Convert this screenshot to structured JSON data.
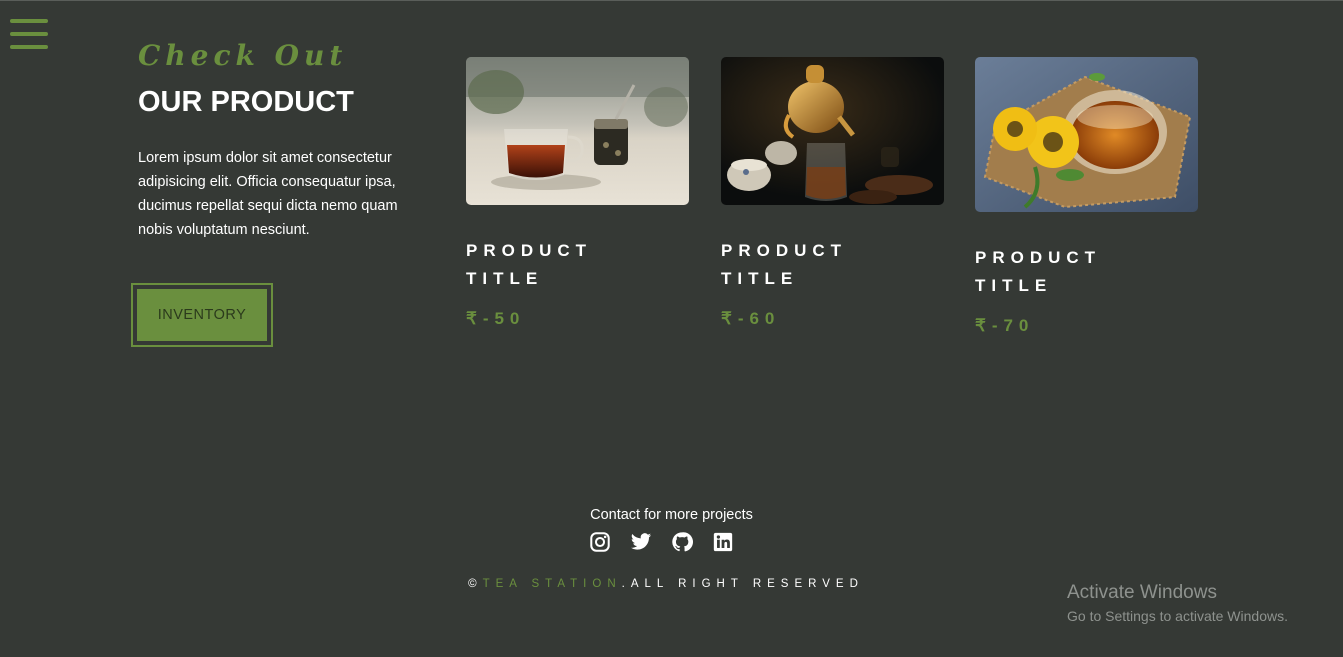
{
  "nav": {
    "menu_icon": "hamburger-menu-icon"
  },
  "intro": {
    "kicker": "Check Out",
    "heading": "OUR PRODUCT",
    "description": "Lorem ipsum dolor sit amet consectetur adipisicing elit. Officia consequatur ipsa, ducimus repellat sequi dicta nemo quam nobis voluptatum nesciunt.",
    "button_label": "INVENTORY"
  },
  "products": [
    {
      "title_line1": "PRODUCT",
      "title_line2": "TITLE",
      "price": "₹-50",
      "image": "glass-tea-cup-on-table-photo"
    },
    {
      "title_line1": "PRODUCT",
      "title_line2": "TITLE",
      "price": "₹-60",
      "image": "teapot-pouring-tea-photo"
    },
    {
      "title_line1": "PRODUCT",
      "title_line2": "TITLE",
      "price": "₹-70",
      "image": "tea-cup-with-yellow-flowers-photo"
    }
  ],
  "footer": {
    "contact_text": "Contact for more projects",
    "social_icons": [
      "instagram-icon",
      "twitter-icon",
      "github-icon",
      "linkedin-icon"
    ],
    "copyright_symbol": "©",
    "brand": "TEA STATION",
    "rights": ".ALL RIGHT RESERVED"
  },
  "watermark": {
    "title": "Activate Windows",
    "subtitle": "Go to Settings to activate Windows."
  },
  "colors": {
    "background": "#353935",
    "accent": "#6a8f3e",
    "text": "#ffffff",
    "watermark": "#8e928e"
  }
}
